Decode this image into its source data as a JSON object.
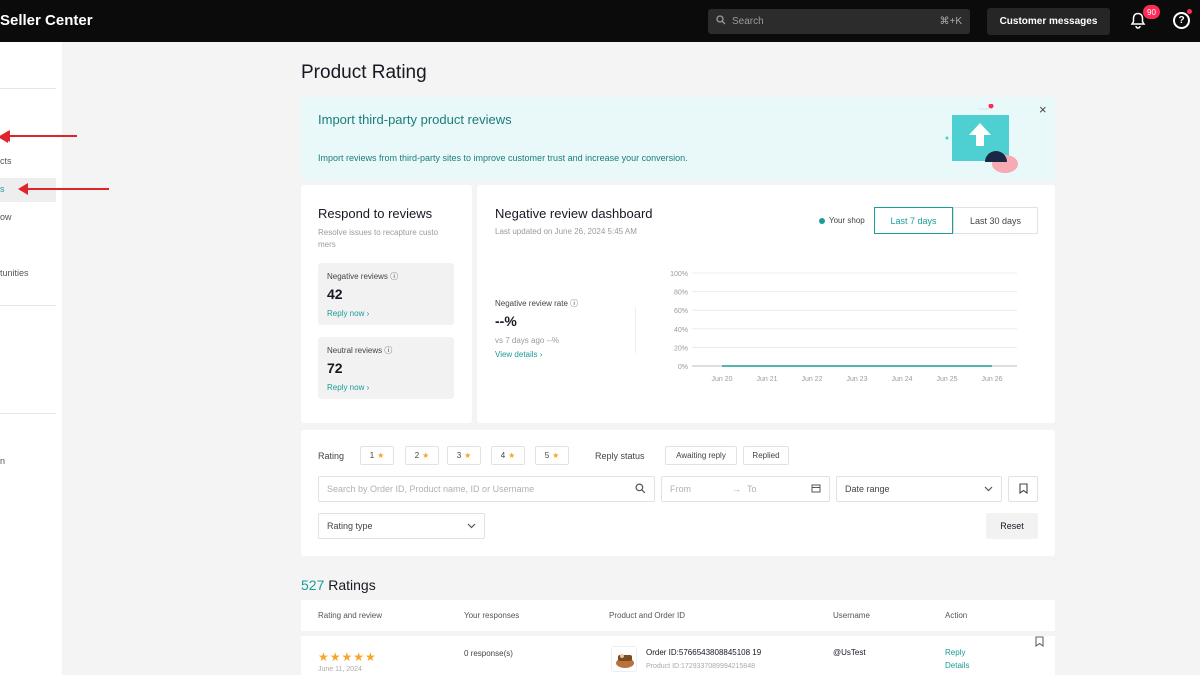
{
  "header": {
    "brand": "Seller Center",
    "search_placeholder": "Search",
    "search_shortcut": "⌘+K",
    "customer_messages": "Customer messages",
    "notification_count": "90",
    "help_glyph": "?"
  },
  "sidebar": {
    "items": [
      "cts",
      "s",
      "ow",
      "tunities",
      "n"
    ],
    "annotation_color": "#e0242c"
  },
  "page": {
    "title": "Product Rating"
  },
  "banner": {
    "title": "Import third-party product reviews",
    "description": "Import reviews from third-party sites to improve customer trust and increase your conversion.",
    "close": "×"
  },
  "respond": {
    "title": "Respond to reviews",
    "subtitle": "Resolve issues to recapture custo mers",
    "negative": {
      "label": "Negative reviews",
      "value": "42",
      "link": "Reply now ›"
    },
    "neutral": {
      "label": "Neutral reviews",
      "value": "72",
      "link": "Reply now ›"
    }
  },
  "dashboard": {
    "title": "Negative review dashboard",
    "updated": "Last updated on June 26, 2024 5:45 AM",
    "legend": "Your shop",
    "range_options": [
      "Last 7 days",
      "Last 30 days"
    ],
    "selected_range": "Last 7 days",
    "metric_label": "Negative review rate",
    "metric_value": "--%",
    "metric_vs": "vs 7 days ago  --%",
    "metric_link": "View details ›"
  },
  "chart_data": {
    "type": "line",
    "categories": [
      "Jun 20",
      "Jun 21",
      "Jun 22",
      "Jun 23",
      "Jun 24",
      "Jun 25",
      "Jun 26"
    ],
    "series": [
      {
        "name": "Your shop",
        "values": [
          0,
          0,
          0,
          0,
          0,
          0,
          0
        ],
        "color": "#1a9c98"
      }
    ],
    "yticks": [
      "0%",
      "20%",
      "40%",
      "60%",
      "80%",
      "100%"
    ],
    "ylim": [
      0,
      100
    ],
    "grid": true
  },
  "filters": {
    "rating_label": "Rating",
    "rating_chips": [
      "1",
      "2",
      "3",
      "4",
      "5"
    ],
    "reply_label": "Reply status",
    "reply_chips": [
      "Awaiting reply",
      "Replied"
    ],
    "search_placeholder": "Search by Order ID, Product name, ID or Username",
    "from_placeholder": "From",
    "to_placeholder": "To",
    "date_range": "Date range",
    "rating_type": "Rating type",
    "reset": "Reset"
  },
  "ratings": {
    "count": "527",
    "label": "Ratings",
    "columns": [
      "Rating and review",
      "Your responses",
      "Product and Order ID",
      "Username",
      "Action"
    ],
    "rows": [
      {
        "stars": "★★★★★",
        "date": "June 11, 2024",
        "responses": "0 response(s)",
        "order_id": "Order ID:5766543808845108 19",
        "product_id": "Product ID:1729337089994215848",
        "username": "@UsTest",
        "reply": "Reply",
        "details": "Details"
      }
    ]
  }
}
